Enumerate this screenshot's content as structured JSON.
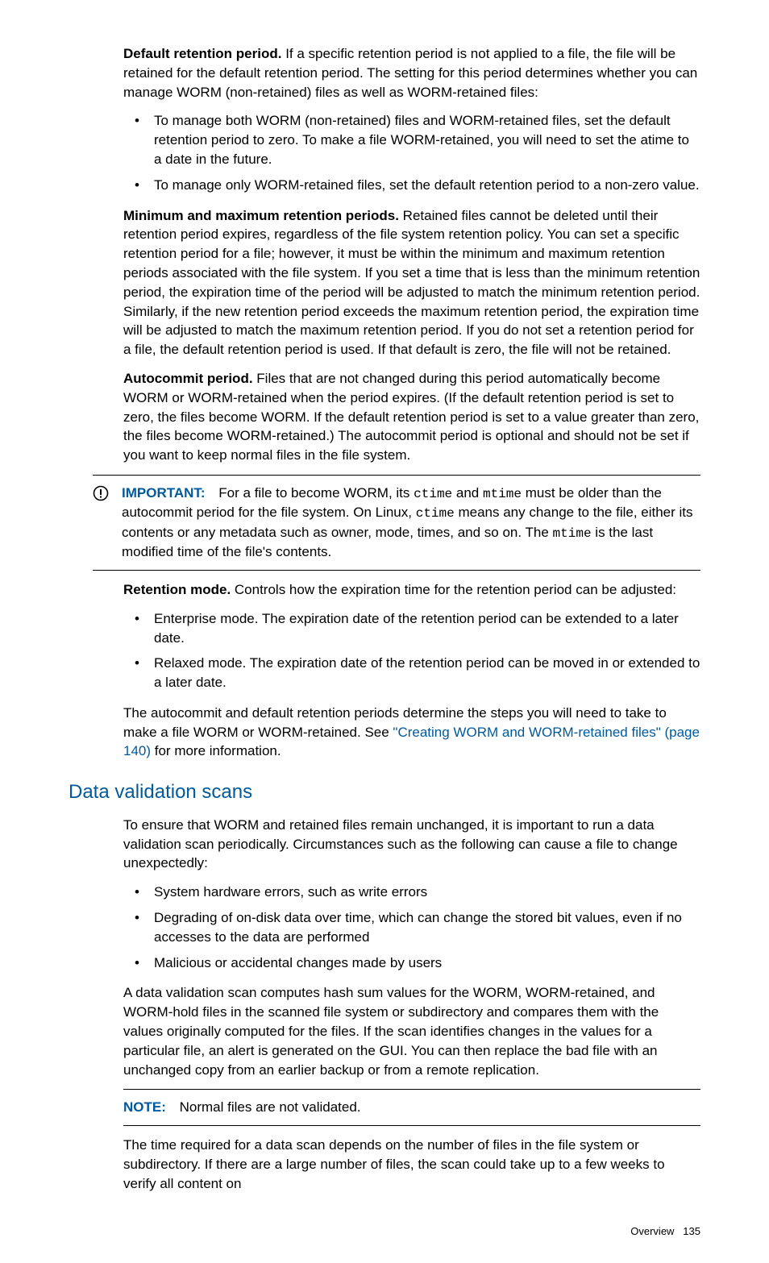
{
  "p1": {
    "lead": "Default retention period.",
    "rest": " If a specific retention period is not applied to a file, the file will be retained for the default retention period. The setting for this period determines whether you can manage WORM (non-retained) files as well as WORM-retained files:"
  },
  "list1": [
    "To manage both WORM (non-retained) files and WORM-retained files, set the default retention period to zero. To make a file WORM-retained, you will need to set the atime to a date in the future.",
    "To manage only WORM-retained files, set the default retention period to a non-zero value."
  ],
  "p2": {
    "lead": "Minimum and maximum retention periods.",
    "rest": " Retained files cannot be deleted until their retention period expires, regardless of the file system retention policy. You can set a specific retention period for a file; however, it must be within the minimum and maximum retention periods associated with the file system. If you set a time that is less than the minimum retention period, the expiration time of the period will be adjusted to match the minimum retention period. Similarly, if the new retention period exceeds the maximum retention period, the expiration time will be adjusted to match the maximum retention period. If you do not set a retention period for a file, the default retention period is used. If that default is zero, the file will not be retained."
  },
  "p3": {
    "lead": "Autocommit period.",
    "rest": " Files that are not changed during this period automatically become WORM or WORM-retained when the period expires. (If the default retention period is set to zero, the files become WORM. If the default retention period is set to a value greater than zero, the files become WORM-retained.) The autocommit period is optional and should not be set if you want to keep normal files in the file system."
  },
  "important": {
    "label": "IMPORTANT:",
    "t1": "For a file to become WORM, its ",
    "c1": "ctime",
    "t2": " and ",
    "c2": "mtime",
    "t3": " must be older than the autocommit period for the file system. On Linux, ",
    "c3": "ctime",
    "t4": " means any change to the file, either its contents or any metadata such as owner, mode, times, and so on. The ",
    "c4": "mtime",
    "t5": " is the last modified time of the file's contents."
  },
  "p4": {
    "lead": "Retention mode.",
    "rest": " Controls how the expiration time for the retention period can be adjusted:"
  },
  "list2": [
    "Enterprise mode. The expiration date of the retention period can be extended to a later date.",
    "Relaxed mode. The expiration date of the retention period can be moved in or extended to a later date."
  ],
  "p5": {
    "t1": "The autocommit and default retention periods determine the steps you will need to take to make a file WORM or WORM-retained. See ",
    "link": "\"Creating WORM and WORM-retained files\" (page 140)",
    "t2": " for more information."
  },
  "heading": "Data validation scans",
  "p6": "To ensure that WORM and retained files remain unchanged, it is important to run a data validation scan periodically. Circumstances such as the following can cause a file to change unexpectedly:",
  "list3": [
    "System hardware errors, such as write errors",
    "Degrading of on-disk data over time, which can change the stored bit values, even if no accesses to the data are performed",
    "Malicious or accidental changes made by users"
  ],
  "p7": "A data validation scan computes hash sum values for the WORM, WORM-retained, and WORM-hold files in the scanned file system or subdirectory and compares them with the values originally computed for the files. If the scan identifies changes in the values for a particular file, an alert is generated on the GUI. You can then replace the bad file with an unchanged copy from an earlier backup or from a remote replication.",
  "note": {
    "label": "NOTE:",
    "text": "Normal files are not validated."
  },
  "p8": "The time required for a data scan depends on the number of files in the file system or subdirectory. If there are a large number of files, the scan could take up to a few weeks to verify all content on",
  "footer": {
    "section": "Overview",
    "page": "135"
  }
}
